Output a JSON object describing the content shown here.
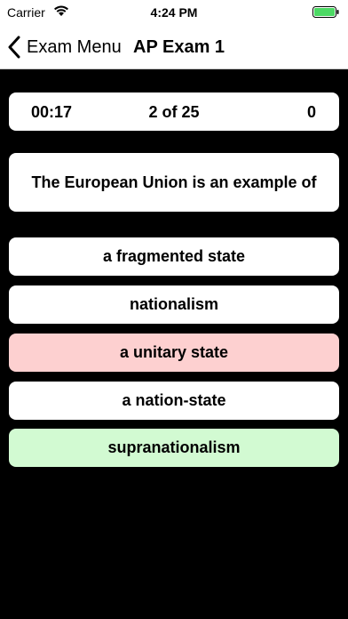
{
  "status_bar": {
    "carrier": "Carrier",
    "time": "4:24 PM",
    "icons": [
      "wifi-icon",
      "battery-icon"
    ],
    "battery_color": "#4cd964"
  },
  "nav": {
    "back_label": "Exam Menu",
    "title": "AP Exam 1"
  },
  "stats": {
    "timer": "00:17",
    "progress": "2 of 25",
    "score": "0"
  },
  "question": "The European Union is an example of",
  "answers": [
    {
      "label": "a fragmented state",
      "state": "neutral"
    },
    {
      "label": "nationalism",
      "state": "neutral"
    },
    {
      "label": "a unitary state",
      "state": "incorrect"
    },
    {
      "label": "a nation-state",
      "state": "neutral"
    },
    {
      "label": "supranationalism",
      "state": "correct"
    }
  ],
  "colors": {
    "background": "#000000",
    "card": "#ffffff",
    "incorrect": "#fdd0d0",
    "correct": "#d2fad2"
  }
}
